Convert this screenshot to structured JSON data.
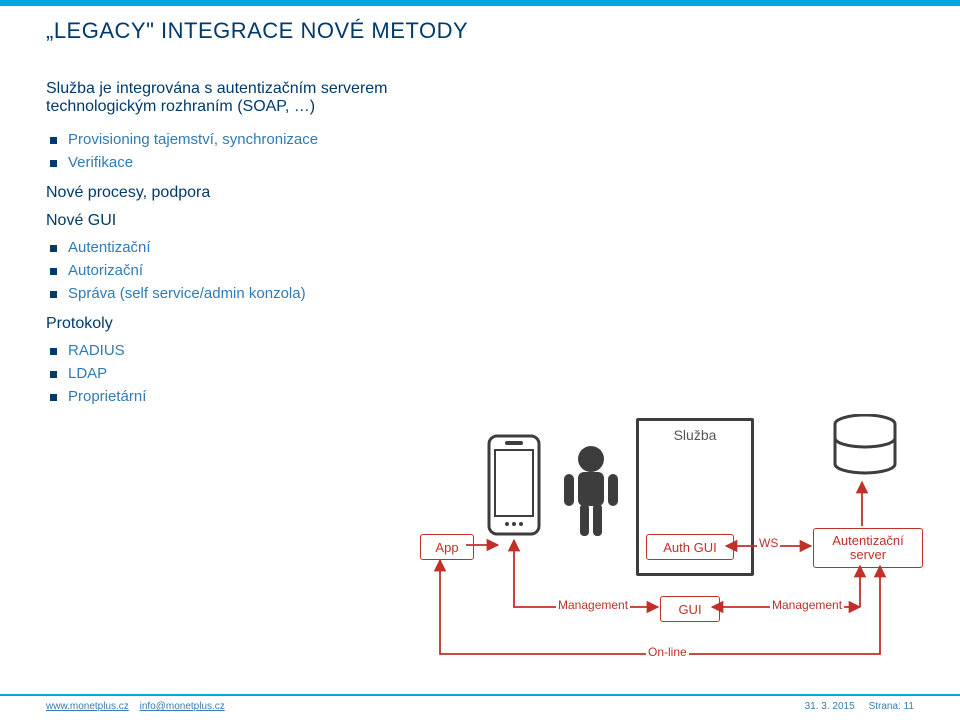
{
  "title": "„LEGACY\" INTEGRACE NOVÉ METODY",
  "intro": "Služba je integrována s autentizačním serverem technologickým rozhraním (SOAP, …)",
  "list1": {
    "a": "Provisioning tajemství, synchronizace",
    "b": "Verifikace"
  },
  "h2a": "Nové procesy, podpora",
  "h2b": "Nové GUI",
  "list2": {
    "a": "Autentizační",
    "b": "Autorizační",
    "c": "Správa (self service/admin konzola)"
  },
  "h2c": "Protokoly",
  "list3": {
    "a": "RADIUS",
    "b": "LDAP",
    "c": "Proprietární"
  },
  "diagram": {
    "app": "App",
    "sluzba": "Služba",
    "authgui": "Auth GUI",
    "ws": "WS",
    "authserver_l1": "Autentizační",
    "authserver_l2": "server",
    "mgmt": "Management",
    "gui": "GUI",
    "online": "On-line"
  },
  "footer": {
    "url": "www.monetplus.cz",
    "mail": "info@monetplus.cz",
    "date": "31. 3. 2015",
    "page_lbl": "Strana:",
    "page_n": "11"
  }
}
